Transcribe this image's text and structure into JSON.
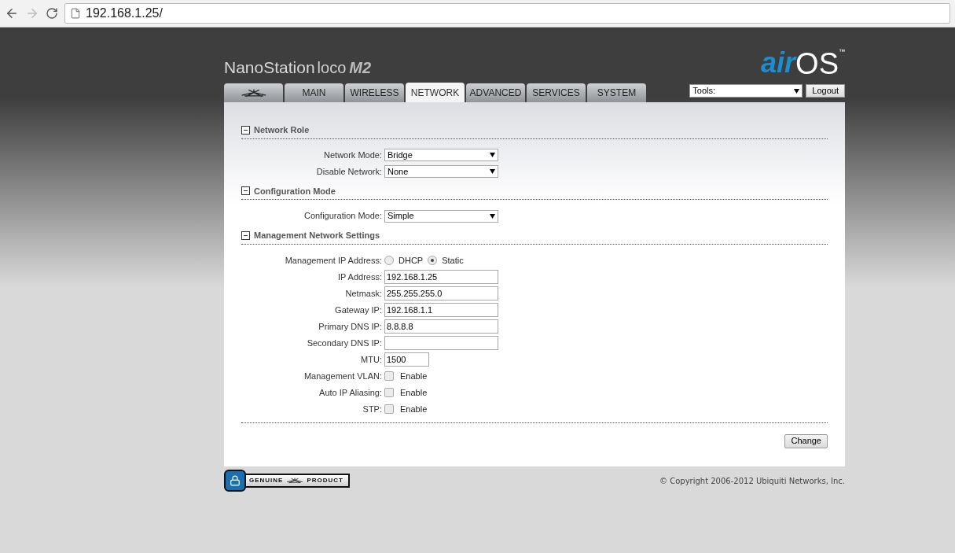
{
  "browser": {
    "url": "192.168.1.25/"
  },
  "header": {
    "product_name": "NanoStation",
    "product_line": "loco",
    "model": "M2",
    "brand_prefix": "air",
    "brand_suffix": "OS",
    "trademark": "™"
  },
  "tabs": [
    {
      "kind": "logo",
      "selected": false
    },
    {
      "kind": "text",
      "label": "MAIN",
      "selected": false
    },
    {
      "kind": "text",
      "label": "WIRELESS",
      "selected": false
    },
    {
      "kind": "text",
      "label": "NETWORK",
      "selected": true
    },
    {
      "kind": "text",
      "label": "ADVANCED",
      "selected": false
    },
    {
      "kind": "text",
      "label": "SERVICES",
      "selected": false
    },
    {
      "kind": "text",
      "label": "SYSTEM",
      "selected": false
    }
  ],
  "tools": {
    "value": "Tools:"
  },
  "logout_button": "Logout",
  "sections": [
    {
      "title": "Network Role",
      "expanded": true,
      "rows": [
        {
          "kind": "select",
          "label": "Network Mode:",
          "value": "Bridge"
        },
        {
          "kind": "select",
          "label": "Disable Network:",
          "value": "None"
        }
      ]
    },
    {
      "title": "Configuration Mode",
      "expanded": true,
      "rows": [
        {
          "kind": "select",
          "label": "Configuration Mode:",
          "value": "Simple"
        }
      ]
    },
    {
      "title": "Management Network Settings",
      "expanded": true,
      "rows": [
        {
          "kind": "radio",
          "label": "Management IP Address:",
          "options": [
            {
              "label": "DHCP",
              "selected": false
            },
            {
              "label": "Static",
              "selected": true
            }
          ]
        },
        {
          "kind": "text",
          "label": "IP Address:",
          "value": "192.168.1.25"
        },
        {
          "kind": "text",
          "label": "Netmask:",
          "value": "255.255.255.0"
        },
        {
          "kind": "text",
          "label": "Gateway IP:",
          "value": "192.168.1.1"
        },
        {
          "kind": "text",
          "label": "Primary DNS IP:",
          "value": "8.8.8.8"
        },
        {
          "kind": "text",
          "label": "Secondary DNS IP:"
        },
        {
          "kind": "short_text",
          "label": "MTU:",
          "value": "1500"
        },
        {
          "kind": "checkbox",
          "label": "Management VLAN:",
          "option": "Enable",
          "checked": false
        },
        {
          "kind": "checkbox",
          "label": "Auto IP Aliasing:",
          "option": "Enable",
          "checked": false
        },
        {
          "kind": "checkbox",
          "label": "STP:",
          "option": "Enable",
          "checked": false
        }
      ]
    }
  ],
  "change_button": "Change",
  "footer": {
    "badge_left": "GENUINE",
    "badge_right": "PRODUCT",
    "copyright": "© Copyright 2006-2012 Ubiquiti Networks, Inc."
  }
}
